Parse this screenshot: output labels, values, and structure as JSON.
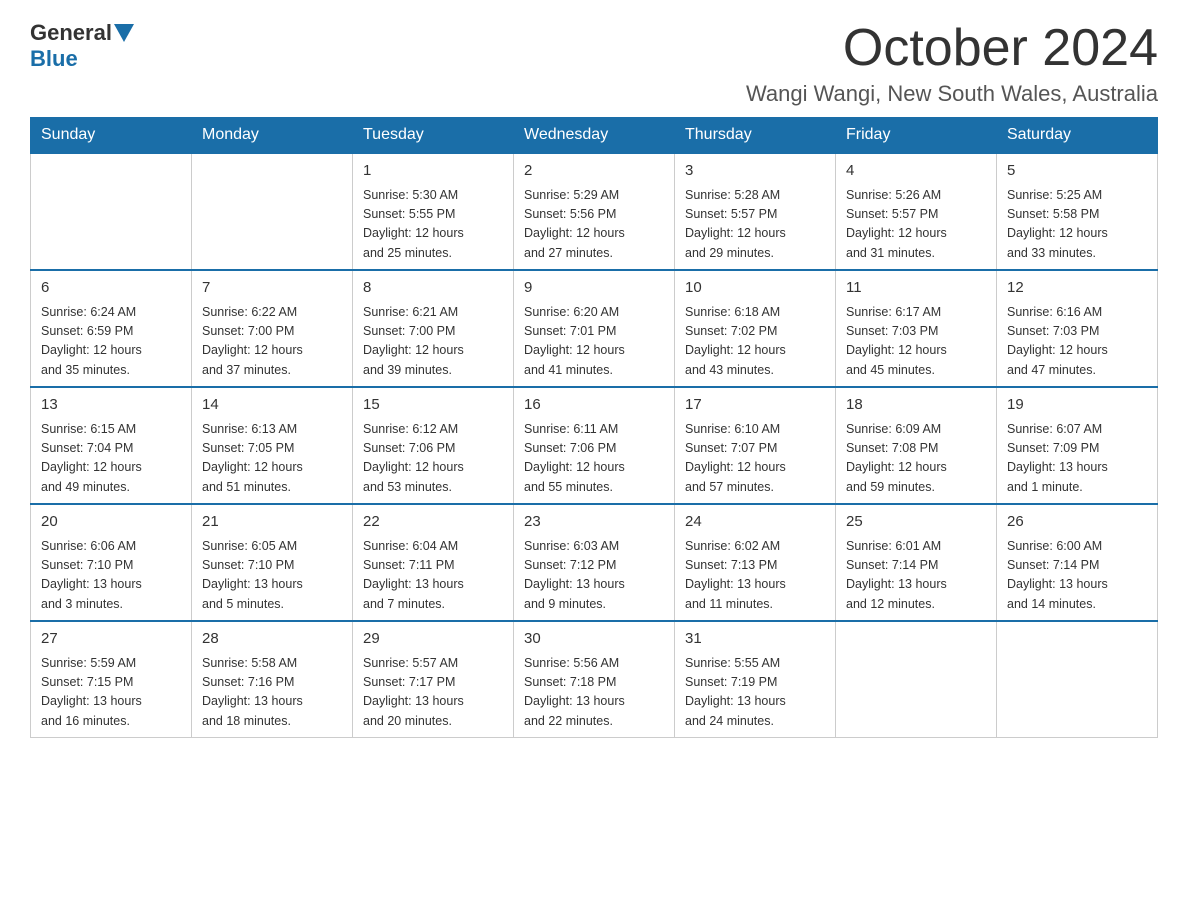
{
  "header": {
    "logo_general": "General",
    "logo_blue": "Blue",
    "title": "October 2024",
    "subtitle": "Wangi Wangi, New South Wales, Australia"
  },
  "days_of_week": [
    "Sunday",
    "Monday",
    "Tuesday",
    "Wednesday",
    "Thursday",
    "Friday",
    "Saturday"
  ],
  "weeks": [
    [
      {
        "day": "",
        "info": ""
      },
      {
        "day": "",
        "info": ""
      },
      {
        "day": "1",
        "info": "Sunrise: 5:30 AM\nSunset: 5:55 PM\nDaylight: 12 hours\nand 25 minutes."
      },
      {
        "day": "2",
        "info": "Sunrise: 5:29 AM\nSunset: 5:56 PM\nDaylight: 12 hours\nand 27 minutes."
      },
      {
        "day": "3",
        "info": "Sunrise: 5:28 AM\nSunset: 5:57 PM\nDaylight: 12 hours\nand 29 minutes."
      },
      {
        "day": "4",
        "info": "Sunrise: 5:26 AM\nSunset: 5:57 PM\nDaylight: 12 hours\nand 31 minutes."
      },
      {
        "day": "5",
        "info": "Sunrise: 5:25 AM\nSunset: 5:58 PM\nDaylight: 12 hours\nand 33 minutes."
      }
    ],
    [
      {
        "day": "6",
        "info": "Sunrise: 6:24 AM\nSunset: 6:59 PM\nDaylight: 12 hours\nand 35 minutes."
      },
      {
        "day": "7",
        "info": "Sunrise: 6:22 AM\nSunset: 7:00 PM\nDaylight: 12 hours\nand 37 minutes."
      },
      {
        "day": "8",
        "info": "Sunrise: 6:21 AM\nSunset: 7:00 PM\nDaylight: 12 hours\nand 39 minutes."
      },
      {
        "day": "9",
        "info": "Sunrise: 6:20 AM\nSunset: 7:01 PM\nDaylight: 12 hours\nand 41 minutes."
      },
      {
        "day": "10",
        "info": "Sunrise: 6:18 AM\nSunset: 7:02 PM\nDaylight: 12 hours\nand 43 minutes."
      },
      {
        "day": "11",
        "info": "Sunrise: 6:17 AM\nSunset: 7:03 PM\nDaylight: 12 hours\nand 45 minutes."
      },
      {
        "day": "12",
        "info": "Sunrise: 6:16 AM\nSunset: 7:03 PM\nDaylight: 12 hours\nand 47 minutes."
      }
    ],
    [
      {
        "day": "13",
        "info": "Sunrise: 6:15 AM\nSunset: 7:04 PM\nDaylight: 12 hours\nand 49 minutes."
      },
      {
        "day": "14",
        "info": "Sunrise: 6:13 AM\nSunset: 7:05 PM\nDaylight: 12 hours\nand 51 minutes."
      },
      {
        "day": "15",
        "info": "Sunrise: 6:12 AM\nSunset: 7:06 PM\nDaylight: 12 hours\nand 53 minutes."
      },
      {
        "day": "16",
        "info": "Sunrise: 6:11 AM\nSunset: 7:06 PM\nDaylight: 12 hours\nand 55 minutes."
      },
      {
        "day": "17",
        "info": "Sunrise: 6:10 AM\nSunset: 7:07 PM\nDaylight: 12 hours\nand 57 minutes."
      },
      {
        "day": "18",
        "info": "Sunrise: 6:09 AM\nSunset: 7:08 PM\nDaylight: 12 hours\nand 59 minutes."
      },
      {
        "day": "19",
        "info": "Sunrise: 6:07 AM\nSunset: 7:09 PM\nDaylight: 13 hours\nand 1 minute."
      }
    ],
    [
      {
        "day": "20",
        "info": "Sunrise: 6:06 AM\nSunset: 7:10 PM\nDaylight: 13 hours\nand 3 minutes."
      },
      {
        "day": "21",
        "info": "Sunrise: 6:05 AM\nSunset: 7:10 PM\nDaylight: 13 hours\nand 5 minutes."
      },
      {
        "day": "22",
        "info": "Sunrise: 6:04 AM\nSunset: 7:11 PM\nDaylight: 13 hours\nand 7 minutes."
      },
      {
        "day": "23",
        "info": "Sunrise: 6:03 AM\nSunset: 7:12 PM\nDaylight: 13 hours\nand 9 minutes."
      },
      {
        "day": "24",
        "info": "Sunrise: 6:02 AM\nSunset: 7:13 PM\nDaylight: 13 hours\nand 11 minutes."
      },
      {
        "day": "25",
        "info": "Sunrise: 6:01 AM\nSunset: 7:14 PM\nDaylight: 13 hours\nand 12 minutes."
      },
      {
        "day": "26",
        "info": "Sunrise: 6:00 AM\nSunset: 7:14 PM\nDaylight: 13 hours\nand 14 minutes."
      }
    ],
    [
      {
        "day": "27",
        "info": "Sunrise: 5:59 AM\nSunset: 7:15 PM\nDaylight: 13 hours\nand 16 minutes."
      },
      {
        "day": "28",
        "info": "Sunrise: 5:58 AM\nSunset: 7:16 PM\nDaylight: 13 hours\nand 18 minutes."
      },
      {
        "day": "29",
        "info": "Sunrise: 5:57 AM\nSunset: 7:17 PM\nDaylight: 13 hours\nand 20 minutes."
      },
      {
        "day": "30",
        "info": "Sunrise: 5:56 AM\nSunset: 7:18 PM\nDaylight: 13 hours\nand 22 minutes."
      },
      {
        "day": "31",
        "info": "Sunrise: 5:55 AM\nSunset: 7:19 PM\nDaylight: 13 hours\nand 24 minutes."
      },
      {
        "day": "",
        "info": ""
      },
      {
        "day": "",
        "info": ""
      }
    ]
  ]
}
